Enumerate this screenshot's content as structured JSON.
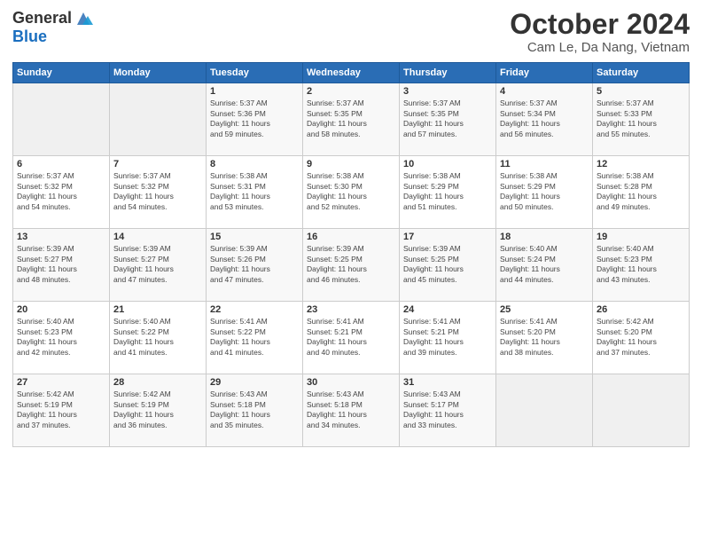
{
  "logo": {
    "general": "General",
    "blue": "Blue"
  },
  "header": {
    "month": "October 2024",
    "location": "Cam Le, Da Nang, Vietnam"
  },
  "days_of_week": [
    "Sunday",
    "Monday",
    "Tuesday",
    "Wednesday",
    "Thursday",
    "Friday",
    "Saturday"
  ],
  "weeks": [
    [
      {
        "day": "",
        "info": ""
      },
      {
        "day": "",
        "info": ""
      },
      {
        "day": "1",
        "info": "Sunrise: 5:37 AM\nSunset: 5:36 PM\nDaylight: 11 hours\nand 59 minutes."
      },
      {
        "day": "2",
        "info": "Sunrise: 5:37 AM\nSunset: 5:35 PM\nDaylight: 11 hours\nand 58 minutes."
      },
      {
        "day": "3",
        "info": "Sunrise: 5:37 AM\nSunset: 5:35 PM\nDaylight: 11 hours\nand 57 minutes."
      },
      {
        "day": "4",
        "info": "Sunrise: 5:37 AM\nSunset: 5:34 PM\nDaylight: 11 hours\nand 56 minutes."
      },
      {
        "day": "5",
        "info": "Sunrise: 5:37 AM\nSunset: 5:33 PM\nDaylight: 11 hours\nand 55 minutes."
      }
    ],
    [
      {
        "day": "6",
        "info": "Sunrise: 5:37 AM\nSunset: 5:32 PM\nDaylight: 11 hours\nand 54 minutes."
      },
      {
        "day": "7",
        "info": "Sunrise: 5:37 AM\nSunset: 5:32 PM\nDaylight: 11 hours\nand 54 minutes."
      },
      {
        "day": "8",
        "info": "Sunrise: 5:38 AM\nSunset: 5:31 PM\nDaylight: 11 hours\nand 53 minutes."
      },
      {
        "day": "9",
        "info": "Sunrise: 5:38 AM\nSunset: 5:30 PM\nDaylight: 11 hours\nand 52 minutes."
      },
      {
        "day": "10",
        "info": "Sunrise: 5:38 AM\nSunset: 5:29 PM\nDaylight: 11 hours\nand 51 minutes."
      },
      {
        "day": "11",
        "info": "Sunrise: 5:38 AM\nSunset: 5:29 PM\nDaylight: 11 hours\nand 50 minutes."
      },
      {
        "day": "12",
        "info": "Sunrise: 5:38 AM\nSunset: 5:28 PM\nDaylight: 11 hours\nand 49 minutes."
      }
    ],
    [
      {
        "day": "13",
        "info": "Sunrise: 5:39 AM\nSunset: 5:27 PM\nDaylight: 11 hours\nand 48 minutes."
      },
      {
        "day": "14",
        "info": "Sunrise: 5:39 AM\nSunset: 5:27 PM\nDaylight: 11 hours\nand 47 minutes."
      },
      {
        "day": "15",
        "info": "Sunrise: 5:39 AM\nSunset: 5:26 PM\nDaylight: 11 hours\nand 47 minutes."
      },
      {
        "day": "16",
        "info": "Sunrise: 5:39 AM\nSunset: 5:25 PM\nDaylight: 11 hours\nand 46 minutes."
      },
      {
        "day": "17",
        "info": "Sunrise: 5:39 AM\nSunset: 5:25 PM\nDaylight: 11 hours\nand 45 minutes."
      },
      {
        "day": "18",
        "info": "Sunrise: 5:40 AM\nSunset: 5:24 PM\nDaylight: 11 hours\nand 44 minutes."
      },
      {
        "day": "19",
        "info": "Sunrise: 5:40 AM\nSunset: 5:23 PM\nDaylight: 11 hours\nand 43 minutes."
      }
    ],
    [
      {
        "day": "20",
        "info": "Sunrise: 5:40 AM\nSunset: 5:23 PM\nDaylight: 11 hours\nand 42 minutes."
      },
      {
        "day": "21",
        "info": "Sunrise: 5:40 AM\nSunset: 5:22 PM\nDaylight: 11 hours\nand 41 minutes."
      },
      {
        "day": "22",
        "info": "Sunrise: 5:41 AM\nSunset: 5:22 PM\nDaylight: 11 hours\nand 41 minutes."
      },
      {
        "day": "23",
        "info": "Sunrise: 5:41 AM\nSunset: 5:21 PM\nDaylight: 11 hours\nand 40 minutes."
      },
      {
        "day": "24",
        "info": "Sunrise: 5:41 AM\nSunset: 5:21 PM\nDaylight: 11 hours\nand 39 minutes."
      },
      {
        "day": "25",
        "info": "Sunrise: 5:41 AM\nSunset: 5:20 PM\nDaylight: 11 hours\nand 38 minutes."
      },
      {
        "day": "26",
        "info": "Sunrise: 5:42 AM\nSunset: 5:20 PM\nDaylight: 11 hours\nand 37 minutes."
      }
    ],
    [
      {
        "day": "27",
        "info": "Sunrise: 5:42 AM\nSunset: 5:19 PM\nDaylight: 11 hours\nand 37 minutes."
      },
      {
        "day": "28",
        "info": "Sunrise: 5:42 AM\nSunset: 5:19 PM\nDaylight: 11 hours\nand 36 minutes."
      },
      {
        "day": "29",
        "info": "Sunrise: 5:43 AM\nSunset: 5:18 PM\nDaylight: 11 hours\nand 35 minutes."
      },
      {
        "day": "30",
        "info": "Sunrise: 5:43 AM\nSunset: 5:18 PM\nDaylight: 11 hours\nand 34 minutes."
      },
      {
        "day": "31",
        "info": "Sunrise: 5:43 AM\nSunset: 5:17 PM\nDaylight: 11 hours\nand 33 minutes."
      },
      {
        "day": "",
        "info": ""
      },
      {
        "day": "",
        "info": ""
      }
    ]
  ]
}
